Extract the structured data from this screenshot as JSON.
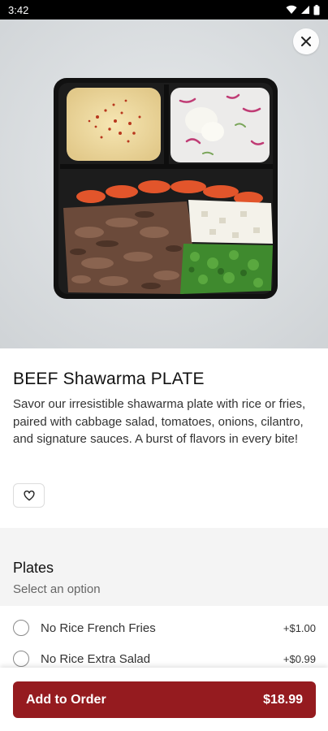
{
  "status_bar": {
    "time": "3:42"
  },
  "item": {
    "title": "BEEF Shawarma PLATE",
    "description": "Savor our irresistible shawarma plate with rice or fries, paired with cabbage salad, tomatoes, onions, cilantro, and signature sauces. A burst of flavors in every bite!"
  },
  "options_section": {
    "title": "Plates",
    "subtitle": "Select an option",
    "options": [
      {
        "label": "No Rice French Fries",
        "price": "+$1.00"
      },
      {
        "label": "No Rice Extra Salad",
        "price": "+$0.99"
      }
    ]
  },
  "cta": {
    "label": "Add to Order",
    "price": "$18.99"
  },
  "colors": {
    "brand": "#951b1f",
    "section_bg": "#f4f4f4"
  },
  "icons": {
    "close": "close-icon",
    "favorite": "heart-outline-icon",
    "wifi": "wifi-icon",
    "signal": "signal-icon",
    "battery": "battery-icon"
  }
}
